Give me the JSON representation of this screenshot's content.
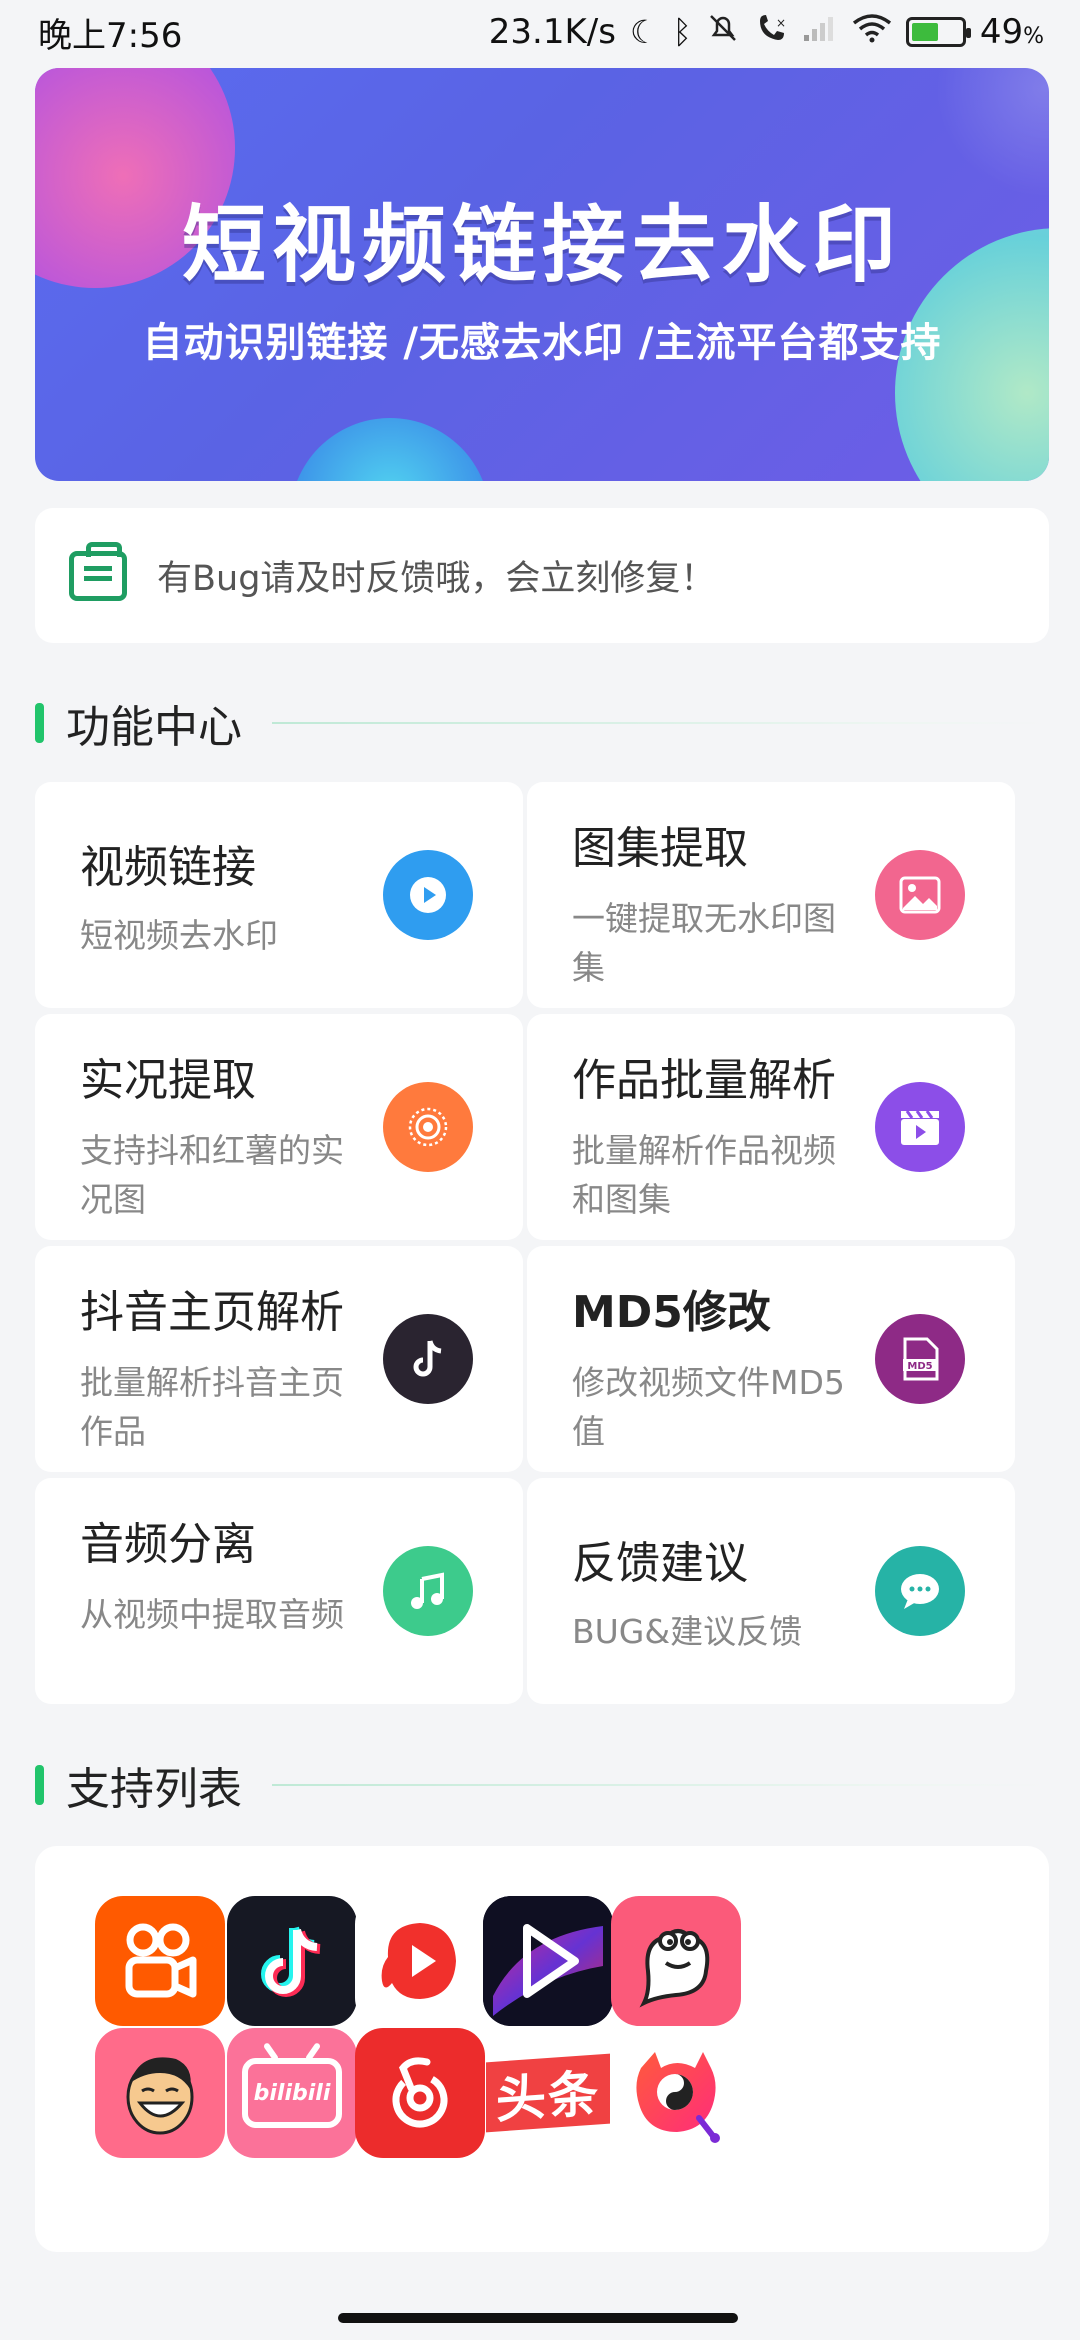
{
  "status_bar": {
    "time": "晚上7:56",
    "net_speed": "23.1K/s",
    "battery": "49",
    "battery_unit": "%",
    "battery_level": 0.49,
    "icons": [
      "moon-icon",
      "bluetooth-icon",
      "mute-icon",
      "phone-off-icon",
      "signal-icon",
      "wifi-icon",
      "battery-icon"
    ]
  },
  "banner": {
    "title": "短视频链接去水印",
    "subtitle": "自动识别链接 /无感去水印 /主流平台都支持"
  },
  "notice": {
    "icon": "toolbox-icon",
    "text": "有Bug请及时反馈哦，会立刻修复！"
  },
  "sections": {
    "features": "功能中心",
    "support": "支持列表"
  },
  "features": [
    {
      "title": "视频链接",
      "desc": "短视频去水印",
      "icon": "play-icon",
      "color": "#2f9df0"
    },
    {
      "title": "图集提取",
      "desc": "一键提取无水印图集",
      "icon": "image-icon",
      "color": "#f2668f"
    },
    {
      "title": "实况提取",
      "desc": "支持抖和红薯的实况图",
      "icon": "live-icon",
      "color": "#ff7a3d"
    },
    {
      "title": "作品批量解析",
      "desc": "批量解析作品视频和图集",
      "icon": "clapper-icon",
      "color": "#8c4ee8"
    },
    {
      "title": "抖音主页解析",
      "desc": "批量解析抖音主页作品",
      "icon": "tiktok-icon",
      "color": "#2a2430"
    },
    {
      "title": "MD5修改",
      "desc": "修改视频文件MD5值",
      "icon": "md5-file-icon",
      "color": "#8e2a86"
    },
    {
      "title": "音频分离",
      "desc": "从视频中提取音频",
      "icon": "music-icon",
      "color": "#3dcb8c"
    },
    {
      "title": "反馈建议",
      "desc": "BUG&建议反馈",
      "icon": "chat-icon",
      "color": "#26b3a6"
    }
  ],
  "platforms": [
    {
      "name": "kuaishou-app-icon",
      "color": "#ff5a00"
    },
    {
      "name": "douyin-app-icon",
      "color": "#161823"
    },
    {
      "name": "xigua-app-icon",
      "color": "#ffffff"
    },
    {
      "name": "weishi-app-icon",
      "color": "#1a1a2e"
    },
    {
      "name": "pipixia-app-icon",
      "color": "#fb5a7a"
    },
    {
      "name": "zuiyou-app-icon",
      "color": "#ff6b8a"
    },
    {
      "name": "bilibili-app-icon",
      "color": "#fb7299",
      "text": "bilibili"
    },
    {
      "name": "netease-music-app-icon",
      "color": "#ec2c2c"
    },
    {
      "name": "toutiao-app-icon",
      "color": "#f04142",
      "text": "头条"
    },
    {
      "name": "huoshan-app-icon",
      "color": "#ffffff"
    }
  ]
}
